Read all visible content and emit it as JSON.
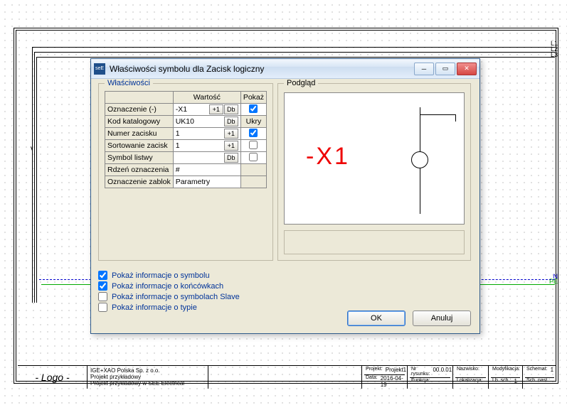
{
  "dialog": {
    "title": "Właściwości symbolu dla Zacisk logiczny",
    "groupbox_props": "Właściwości",
    "groupbox_preview": "Podgląd",
    "headers": {
      "value": "Wartość",
      "show": "Pokaż"
    },
    "rows": [
      {
        "label": "Oznaczenie (-)",
        "value": "-X1",
        "btn1": "+1",
        "btn2": "Db",
        "checked": true
      },
      {
        "label": "Kod katalogowy",
        "value": "UK10",
        "btn1": "",
        "btn2": "Db",
        "extra": "Ukry"
      },
      {
        "label": "Numer zacisku",
        "value": "1",
        "btn1": "+1",
        "btn2": "",
        "checked": true
      },
      {
        "label": "Sortowanie zacisk",
        "value": "1",
        "btn1": "+1",
        "btn2": "",
        "checked": false
      },
      {
        "label": "Symbol listwy",
        "value": "",
        "btn1": "",
        "btn2": "Db",
        "checked": false
      },
      {
        "label": "Rdzeń oznaczenia",
        "value": "#",
        "btn1": "",
        "btn2": "",
        "nochk": true
      },
      {
        "label": "Oznaczenie zablok",
        "value": "Parametry",
        "btn1": "",
        "btn2": "",
        "nochk": true
      }
    ],
    "checks": [
      {
        "label": "Pokaż informacje o symbolu",
        "checked": true
      },
      {
        "label": "Pokaż informacje o końcówkach",
        "checked": true
      },
      {
        "label": "Pokaż informacje o symbolach Slave",
        "checked": false
      },
      {
        "label": "Pokaż informacje o typie",
        "checked": false
      }
    ],
    "preview_text": "-X1",
    "ok": "OK",
    "cancel": "Anuluj"
  },
  "titleblock": {
    "logo": "- Logo -",
    "desc1": "IGE+XAO Polska Sp. z o.o.",
    "desc2": "Projekt przykładowy",
    "desc3": "Projekt przykładowy w SEE Electrical",
    "project_k": "Projekt:",
    "project_v": "Projekt1",
    "drawno_k": "Nr rysunku:",
    "drawno_v": "00.0.01",
    "date_k": "Data:",
    "date_v": "2016-04-19",
    "func_k": "Funkcja:",
    "loc_k": "Lokalizacja:",
    "name_k": "Nazwisko:",
    "mod_k": "Modyfikacja:",
    "schem_k": "Schemat:",
    "schem_v": "1",
    "lb_k": "Lb. sch.:",
    "lb_v": "1",
    "next_k": "Sch. nast.:"
  },
  "wire_labels": {
    "l1": "L1",
    "l2": "L2",
    "l3": "L3",
    "pe": "PE",
    "n": "N"
  }
}
